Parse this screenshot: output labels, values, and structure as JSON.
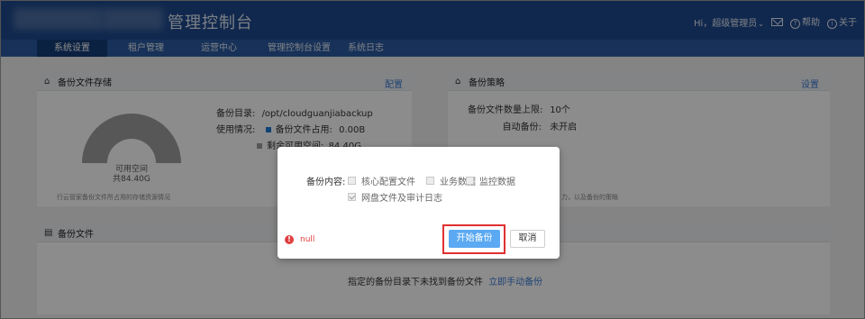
{
  "header": {
    "app_title": "管理控制台",
    "greeting": "Hi，超级管理员",
    "help": "帮助",
    "about": "关于",
    "icons": [
      "mail-icon",
      "help-icon",
      "info-icon"
    ]
  },
  "nav": {
    "items": [
      {
        "label": "系统设置",
        "active": true
      },
      {
        "label": "租户管理",
        "active": false
      },
      {
        "label": "运营中心",
        "active": false
      },
      {
        "label": "管理控制台设置",
        "active": false
      },
      {
        "label": "系统日志",
        "active": false
      }
    ]
  },
  "storage_panel": {
    "title": "备份文件存储",
    "config_link": "配置",
    "dir_label": "备份目录:",
    "dir_value": "/opt/cloudguanjiabackup",
    "usage_label": "使用情况:",
    "used_label": "备份文件占用:",
    "used_value": "0.00B",
    "free_label": "剩余可用空间:",
    "free_value": "84.40G",
    "gauge_title": "可用空间",
    "gauge_value": "共84.40G",
    "note": "行云管家备份文件所占用的存储资源情况",
    "colors": {
      "used": "#1e7bd6",
      "free": "#9e9e9e"
    }
  },
  "policy_panel": {
    "title": "备份策略",
    "settings_link": "设置",
    "limit_label": "备份文件数量上限:",
    "limit_value": "10个",
    "auto_label": "自动备份:",
    "auto_value": "未开启",
    "note": "力，以及备份的策略"
  },
  "files_panel": {
    "title": "备份文件",
    "empty_text": "指定的备份目录下未找到备份文件",
    "manual_backup_link": "立即手动备份"
  },
  "dialog": {
    "content_label": "备份内容:",
    "options": [
      {
        "label": "核心配置文件",
        "checked": false
      },
      {
        "label": "业务数据",
        "checked": false
      },
      {
        "label": "监控数据",
        "checked": false
      },
      {
        "label": "网盘文件及审计日志",
        "checked": true
      }
    ],
    "error_text": "null",
    "start_button": "开始备份",
    "cancel_button": "取消",
    "colors": {
      "primary": "#5aa9f2",
      "error": "#e04040",
      "highlight": "#e03030"
    }
  }
}
